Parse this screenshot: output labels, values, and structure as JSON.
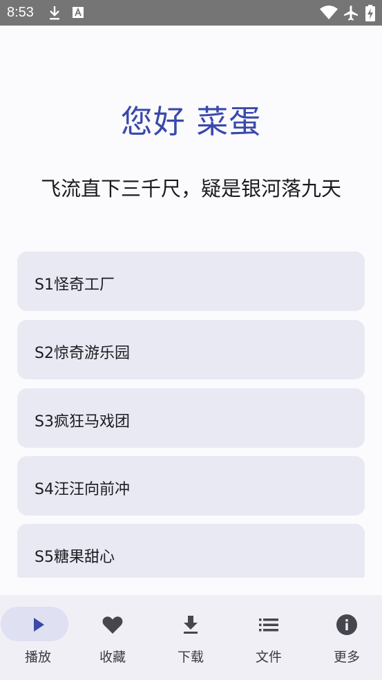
{
  "status_bar": {
    "time": "8:53",
    "icons": [
      "download-icon",
      "font-icon",
      "wifi-icon",
      "airplane-icon",
      "battery-charging-icon"
    ]
  },
  "header": {
    "greeting": "您好 菜蛋",
    "quote": "飞流直下三千尺，疑是银河落九天"
  },
  "list": {
    "items": [
      {
        "label": "S1怪奇工厂"
      },
      {
        "label": "S2惊奇游乐园"
      },
      {
        "label": "S3疯狂马戏团"
      },
      {
        "label": "S4汪汪向前冲"
      },
      {
        "label": "S5糖果甜心"
      }
    ]
  },
  "bottom_nav": {
    "active": "play",
    "items": [
      {
        "label": "播放",
        "icon": "play-icon"
      },
      {
        "label": "收藏",
        "icon": "heart-icon"
      },
      {
        "label": "下载",
        "icon": "download-icon"
      },
      {
        "label": "文件",
        "icon": "list-icon"
      },
      {
        "label": "更多",
        "icon": "info-icon"
      }
    ]
  },
  "colors": {
    "accent": "#3949ab",
    "card": "#e9e9f3",
    "status_bar": "#757575",
    "nav_bg": "#f0eff6",
    "nav_active": "#dfe0f2"
  }
}
